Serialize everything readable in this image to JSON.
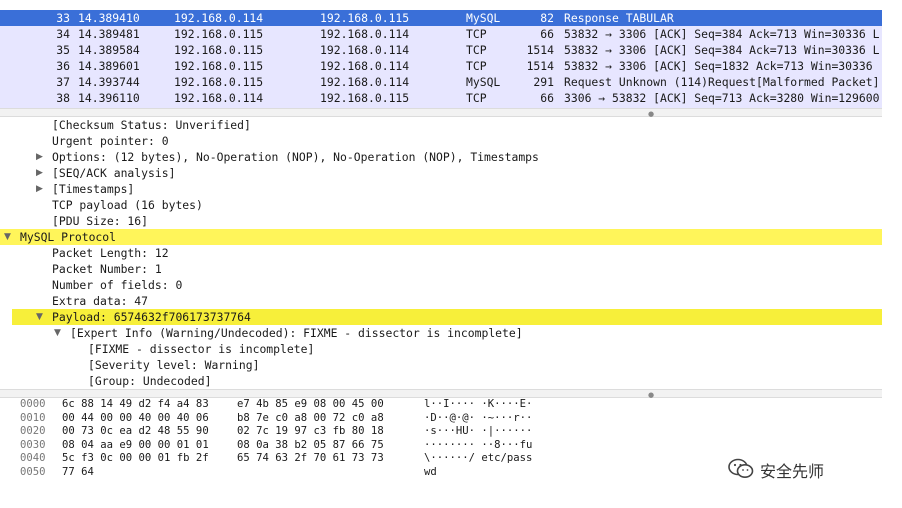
{
  "packet_list": {
    "rows": [
      {
        "no": "33",
        "time": "14.389410",
        "src": "192.168.0.114",
        "dst": "192.168.0.115",
        "proto": "MySQL",
        "len": "82",
        "info": "Response TABULAR",
        "selected": true
      },
      {
        "no": "34",
        "time": "14.389481",
        "src": "192.168.0.115",
        "dst": "192.168.0.114",
        "proto": "TCP",
        "len": "66",
        "info": "53832 → 3306 [ACK] Seq=384 Ack=713 Win=30336 L"
      },
      {
        "no": "35",
        "time": "14.389584",
        "src": "192.168.0.115",
        "dst": "192.168.0.114",
        "proto": "TCP",
        "len": "1514",
        "info": "53832 → 3306 [ACK] Seq=384 Ack=713 Win=30336 L"
      },
      {
        "no": "36",
        "time": "14.389601",
        "src": "192.168.0.115",
        "dst": "192.168.0.114",
        "proto": "TCP",
        "len": "1514",
        "info": "53832 → 3306 [ACK] Seq=1832 Ack=713 Win=30336"
      },
      {
        "no": "37",
        "time": "14.393744",
        "src": "192.168.0.115",
        "dst": "192.168.0.114",
        "proto": "MySQL",
        "len": "291",
        "info": "Request Unknown (114)Request[Malformed Packet]"
      },
      {
        "no": "38",
        "time": "14.396110",
        "src": "192.168.0.114",
        "dst": "192.168.0.115",
        "proto": "TCP",
        "len": "66",
        "info": "3306 → 53832 [ACK] Seq=713 Ack=3280 Win=129600"
      }
    ],
    "selected_bg": "#3a6fd8",
    "row_bg": "#e7e6ff"
  },
  "details": {
    "rows": [
      {
        "indent": 2,
        "tri": "",
        "text": "[Checksum Status: Unverified]"
      },
      {
        "indent": 2,
        "tri": "",
        "text": "Urgent pointer: 0"
      },
      {
        "indent": 2,
        "tri": "▶",
        "text": "Options: (12 bytes), No-Operation (NOP), No-Operation (NOP), Timestamps"
      },
      {
        "indent": 2,
        "tri": "▶",
        "text": "[SEQ/ACK analysis]"
      },
      {
        "indent": 2,
        "tri": "▶",
        "text": "[Timestamps]"
      },
      {
        "indent": 2,
        "tri": "",
        "text": "TCP payload (16 bytes)"
      },
      {
        "indent": 2,
        "tri": "",
        "text": "[PDU Size: 16]"
      },
      {
        "indent": 1,
        "tri": "▼",
        "text": "MySQL Protocol",
        "highlight": "hl"
      },
      {
        "indent": 2,
        "tri": "",
        "text": "Packet Length: 12"
      },
      {
        "indent": 2,
        "tri": "",
        "text": "Packet Number: 1"
      },
      {
        "indent": 2,
        "tri": "",
        "text": "Number of fields: 0"
      },
      {
        "indent": 2,
        "tri": "",
        "text": "Extra data: 47"
      },
      {
        "indent": 2,
        "tri": "▼",
        "text": "Payload: 6574632f706173737764",
        "highlight": "hl-sel"
      },
      {
        "indent": 3,
        "tri": "▼",
        "text": "[Expert Info (Warning/Undecoded): FIXME - dissector is incomplete]"
      },
      {
        "indent": 4,
        "tri": "",
        "text": "[FIXME - dissector is incomplete]"
      },
      {
        "indent": 4,
        "tri": "",
        "text": "[Severity level: Warning]"
      },
      {
        "indent": 4,
        "tri": "",
        "text": "[Group: Undecoded]"
      }
    ],
    "highlight_color": "#fff55a"
  },
  "hex": {
    "rows": [
      {
        "off": "0000",
        "a": "6c 88 14 49 d2 f4 a4 83",
        "b": "e7 4b 85 e9 08 00 45 00",
        "ascii": "l··I···· ·K····E·"
      },
      {
        "off": "0010",
        "a": "00 44 00 00 40 00 40 06",
        "b": "b8 7e c0 a8 00 72 c0 a8",
        "ascii": "·D··@·@· ·~···r··"
      },
      {
        "off": "0020",
        "a": "00 73 0c ea d2 48 55 90",
        "b": "02 7c 19 97 c3 fb 80 18",
        "ascii": "·s···HU· ·|······"
      },
      {
        "off": "0030",
        "a": "08 04 aa e9 00 00 01 01",
        "b": "08 0a 38 b2 05 87 66 75",
        "ascii": "········ ··8···fu"
      },
      {
        "off": "0040",
        "a": "5c f3 0c 00 00 01 fb 2f",
        "b": "65 74 63 2f 70 61 73 73",
        "ascii": "\\······/ etc/pass"
      },
      {
        "off": "0050",
        "a": "77 64",
        "b": "",
        "ascii": "wd"
      }
    ]
  },
  "watermark": {
    "text": "安全先师",
    "icon": "wechat-icon"
  }
}
